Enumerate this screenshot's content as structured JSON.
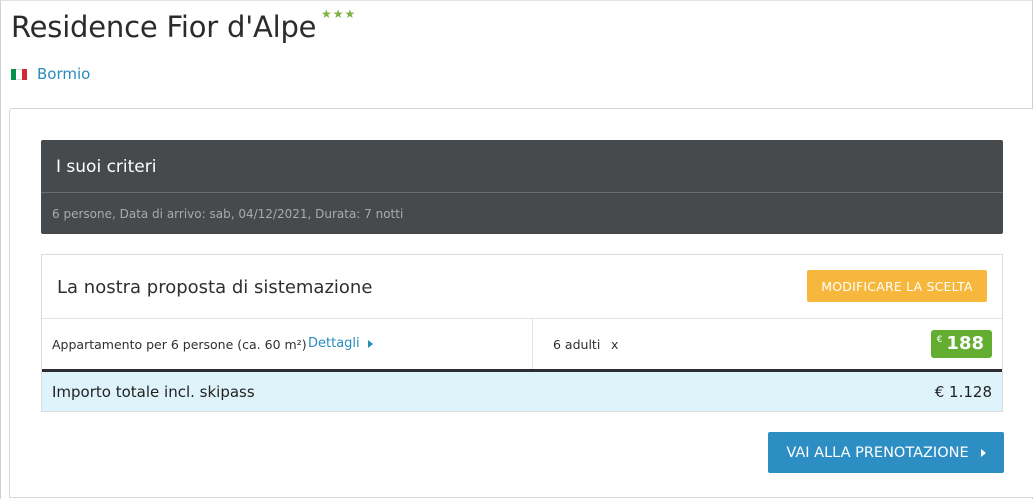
{
  "hotel": {
    "name": "Residence Fior d'Alpe",
    "stars_display": "★★★",
    "star_color": "#7cb342",
    "location": "Bormio",
    "flag_icon": "italy-flag-icon"
  },
  "criteria": {
    "title": "I suoi criteri",
    "details": "6 persone, Data di arrivo: sab, 04/12/2021, Durata: 7 notti"
  },
  "proposal": {
    "title": "La nostra proposta di sistemazione",
    "modify_label": "MODIFICARE LA SCELTA",
    "room": {
      "name": "Appartamento per 6 persone (ca. 60 m²)",
      "details_link": "Dettagli",
      "occupancy": "6 adulti",
      "remove_label": "x",
      "price_currency": "€",
      "price_value": "188"
    },
    "total": {
      "label": "Importo totale incl. skipass",
      "value": "€ 1.128"
    }
  },
  "actions": {
    "book_label": "VAI ALLA PRENOTAZIONE"
  },
  "colors": {
    "accent_blue": "#2c8ec2",
    "link_blue": "#2a8bbd",
    "orange_button": "#f6b73c",
    "price_green": "#63ae31",
    "criteria_bg": "#474a4c",
    "total_bg": "#dff3fb"
  }
}
